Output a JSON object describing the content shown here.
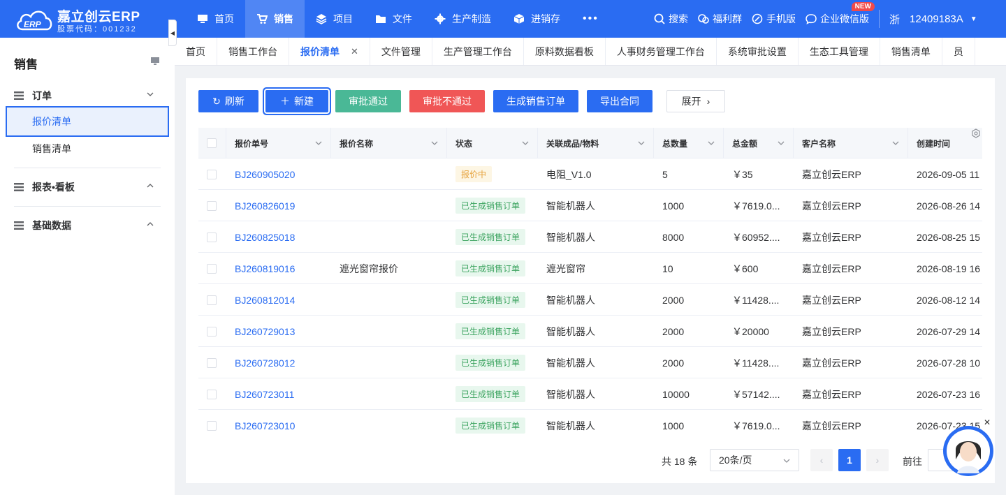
{
  "brand": {
    "name": "嘉立创云ERP",
    "stock_code": "股票代码：001232",
    "logo_letters": "ERP"
  },
  "nav": [
    {
      "label": "首页",
      "icon": "monitor-icon"
    },
    {
      "label": "销售",
      "icon": "cart-icon",
      "active": true
    },
    {
      "label": "项目",
      "icon": "layers-icon"
    },
    {
      "label": "文件",
      "icon": "folder-icon"
    },
    {
      "label": "生产制造",
      "icon": "gear-icon"
    },
    {
      "label": "进销存",
      "icon": "box-icon"
    }
  ],
  "nav_more": "•••",
  "tools": {
    "search": "搜索",
    "welfare": "福利群",
    "mobile": "手机版",
    "wecom": "企业微信版",
    "new_badge": "NEW"
  },
  "user": {
    "province": "浙",
    "account": "12409183A",
    "caret": "▼"
  },
  "sidebar": {
    "title": "销售",
    "groups": [
      {
        "label": "订单",
        "expanded": true,
        "items": [
          {
            "label": "报价清单",
            "active": true
          },
          {
            "label": "销售清单"
          }
        ]
      },
      {
        "label": "报表•看板",
        "expanded": false
      },
      {
        "label": "基础数据",
        "expanded": false
      }
    ]
  },
  "tabs": [
    {
      "label": "首页"
    },
    {
      "label": "销售工作台"
    },
    {
      "label": "报价清单",
      "active": true,
      "close": "✕"
    },
    {
      "label": "文件管理"
    },
    {
      "label": "生产管理工作台"
    },
    {
      "label": "原料数据看板"
    },
    {
      "label": "人事财务管理工作台"
    },
    {
      "label": "系统审批设置"
    },
    {
      "label": "生态工具管理"
    },
    {
      "label": "销售清单"
    },
    {
      "label": "员"
    }
  ],
  "toolbar": {
    "refresh": "刷新",
    "create": "新建",
    "approve": "审批通过",
    "reject": "审批不通过",
    "gen_order": "生成销售订单",
    "export": "导出合同",
    "expand": "展开",
    "refresh_icon": "↻",
    "create_icon": "＋",
    "expand_icon": "›"
  },
  "colors": {
    "primary": "#2a6cf2",
    "approve": "#4ab896",
    "reject": "#f05656"
  },
  "table": {
    "columns": [
      "报价单号",
      "报价名称",
      "状态",
      "关联成品/物料",
      "总数量",
      "总金额",
      "客户名称",
      "创建时间"
    ],
    "rows": [
      {
        "no": "BJ260905020",
        "name": "",
        "status": "报价中",
        "status_type": "warn",
        "product": "电阻_V1.0",
        "qty": "5",
        "amount": "￥35",
        "customer": "嘉立创云ERP",
        "created": "2026-09-05 11"
      },
      {
        "no": "BJ260826019",
        "name": "",
        "status": "已生成销售订单",
        "status_type": "ok",
        "product": "智能机器人",
        "qty": "1000",
        "amount": "￥7619.0...",
        "customer": "嘉立创云ERP",
        "created": "2026-08-26 14"
      },
      {
        "no": "BJ260825018",
        "name": "",
        "status": "已生成销售订单",
        "status_type": "ok",
        "product": "智能机器人",
        "qty": "8000",
        "amount": "￥60952....",
        "customer": "嘉立创云ERP",
        "created": "2026-08-25 15"
      },
      {
        "no": "BJ260819016",
        "name": "遮光窗帘报价",
        "status": "已生成销售订单",
        "status_type": "ok",
        "product": "遮光窗帘",
        "qty": "10",
        "amount": "￥600",
        "customer": "嘉立创云ERP",
        "created": "2026-08-19 16"
      },
      {
        "no": "BJ260812014",
        "name": "",
        "status": "已生成销售订单",
        "status_type": "ok",
        "product": "智能机器人",
        "qty": "2000",
        "amount": "￥11428....",
        "customer": "嘉立创云ERP",
        "created": "2026-08-12 14"
      },
      {
        "no": "BJ260729013",
        "name": "",
        "status": "已生成销售订单",
        "status_type": "ok",
        "product": "智能机器人",
        "qty": "2000",
        "amount": "￥20000",
        "customer": "嘉立创云ERP",
        "created": "2026-07-29 14"
      },
      {
        "no": "BJ260728012",
        "name": "",
        "status": "已生成销售订单",
        "status_type": "ok",
        "product": "智能机器人",
        "qty": "2000",
        "amount": "￥11428....",
        "customer": "嘉立创云ERP",
        "created": "2026-07-28 10"
      },
      {
        "no": "BJ260723011",
        "name": "",
        "status": "已生成销售订单",
        "status_type": "ok",
        "product": "智能机器人",
        "qty": "10000",
        "amount": "￥57142....",
        "customer": "嘉立创云ERP",
        "created": "2026-07-23 16"
      },
      {
        "no": "BJ260723010",
        "name": "",
        "status": "已生成销售订单",
        "status_type": "ok",
        "product": "智能机器人",
        "qty": "1000",
        "amount": "￥7619.0...",
        "customer": "嘉立创云ERP",
        "created": "2026-07-23 15"
      }
    ]
  },
  "pagination": {
    "total": "共 18 条",
    "page_size": "20条/页",
    "current": "1",
    "goto": "前往",
    "prev": "‹",
    "next": "›"
  },
  "assistant": {
    "close": "✕"
  }
}
